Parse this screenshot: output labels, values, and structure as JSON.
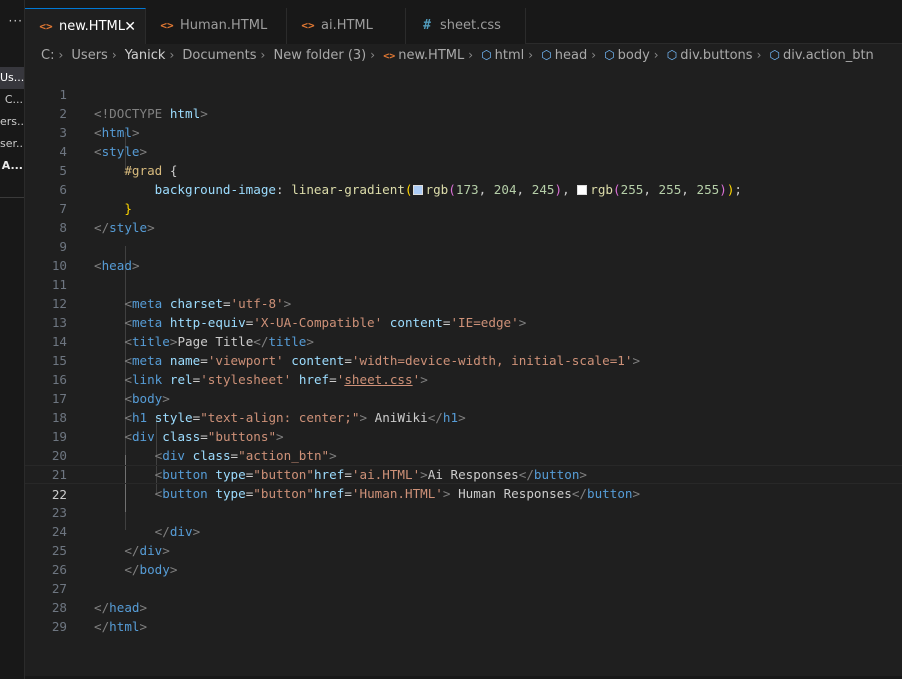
{
  "explorer": {
    "items": [
      {
        "label": "Us...",
        "active": true
      },
      {
        "label": "C..."
      },
      {
        "label": "ers..."
      },
      {
        "label": "ser..."
      },
      {
        "label": "A...",
        "bold": true
      }
    ]
  },
  "tabs": [
    {
      "label": "new.HTML",
      "icon": "html-file-icon",
      "active": true
    },
    {
      "label": "Human.HTML",
      "icon": "html-file-icon"
    },
    {
      "label": "ai.HTML",
      "icon": "html-file-icon"
    },
    {
      "label": "sheet.css",
      "icon": "css-file-icon"
    }
  ],
  "breadcrumb": [
    "C:",
    "Users",
    "Yanick",
    "Documents",
    "New folder (3)",
    "new.HTML",
    "html",
    "head",
    "body",
    "div.buttons",
    "div.action_btn"
  ],
  "editor": {
    "current_line": 22,
    "line_numbers": [
      "1",
      "2",
      "3",
      "4",
      "5",
      "6",
      "7",
      "8",
      "9",
      "10",
      "11",
      "12",
      "13",
      "14",
      "15",
      "16",
      "17",
      "18",
      "19",
      "20",
      "21",
      "22",
      "23",
      "24",
      "25",
      "26",
      "27",
      "28",
      "29"
    ],
    "swatch_colors": [
      "#adccf5",
      "#ffffff"
    ],
    "tokens": {
      "doctype_open": "<!DOCTYPE",
      "doctype_html": "html",
      "gt": ">",
      "html_open_lt": "<",
      "html_tag": "html",
      "style_tag": "style",
      "selector": "#grad",
      "brace_open": "{",
      "prop_bg": "background-image",
      "colon": ":",
      "fn_lg": "linear-gradient",
      "paren_open": "(",
      "fn_rgb1": "rgb",
      "n173": "173",
      "n204": "204",
      "n245": "245",
      "comma": ",",
      "fn_rgb2": "rgb",
      "n255": "255",
      "paren_close": ")",
      "semi": ";",
      "brace_close": "}",
      "close_style": "</",
      "head_tag": "head",
      "meta_tag": "meta",
      "attr_charset": "charset",
      "eq": "=",
      "val_utf8": "'utf-8'",
      "attr_httpequiv": "http-equiv",
      "val_xua": "'X-UA-Compatible'",
      "attr_content": "content",
      "val_ieedge": "'IE=edge'",
      "title_tag": "title",
      "title_text": "Page Title",
      "attr_name": "name",
      "val_viewport": "'viewport'",
      "val_vpcontent": "'width=device-width, initial-scale=1'",
      "link_tag": "link",
      "attr_rel": "rel",
      "val_stylesheet": "'stylesheet'",
      "attr_href": "href",
      "q": "'",
      "val_sheet": "sheet.css",
      "body_tag": "body",
      "h1_tag": "h1",
      "attr_style": "style",
      "val_center": "\"text-align: center;\"",
      "h1_text": " AniWiki",
      "div_tag": "div",
      "attr_class": "class",
      "val_buttons": "\"buttons\"",
      "val_action": "\"action_btn\"",
      "button_tag": "button",
      "attr_type": "type",
      "val_button": "\"button\"",
      "val_ai": "'ai.HTML'",
      "btn1_text": "Ai Responses",
      "val_human": "'Human.HTML'",
      "btn2_text": " Human Responses"
    }
  }
}
